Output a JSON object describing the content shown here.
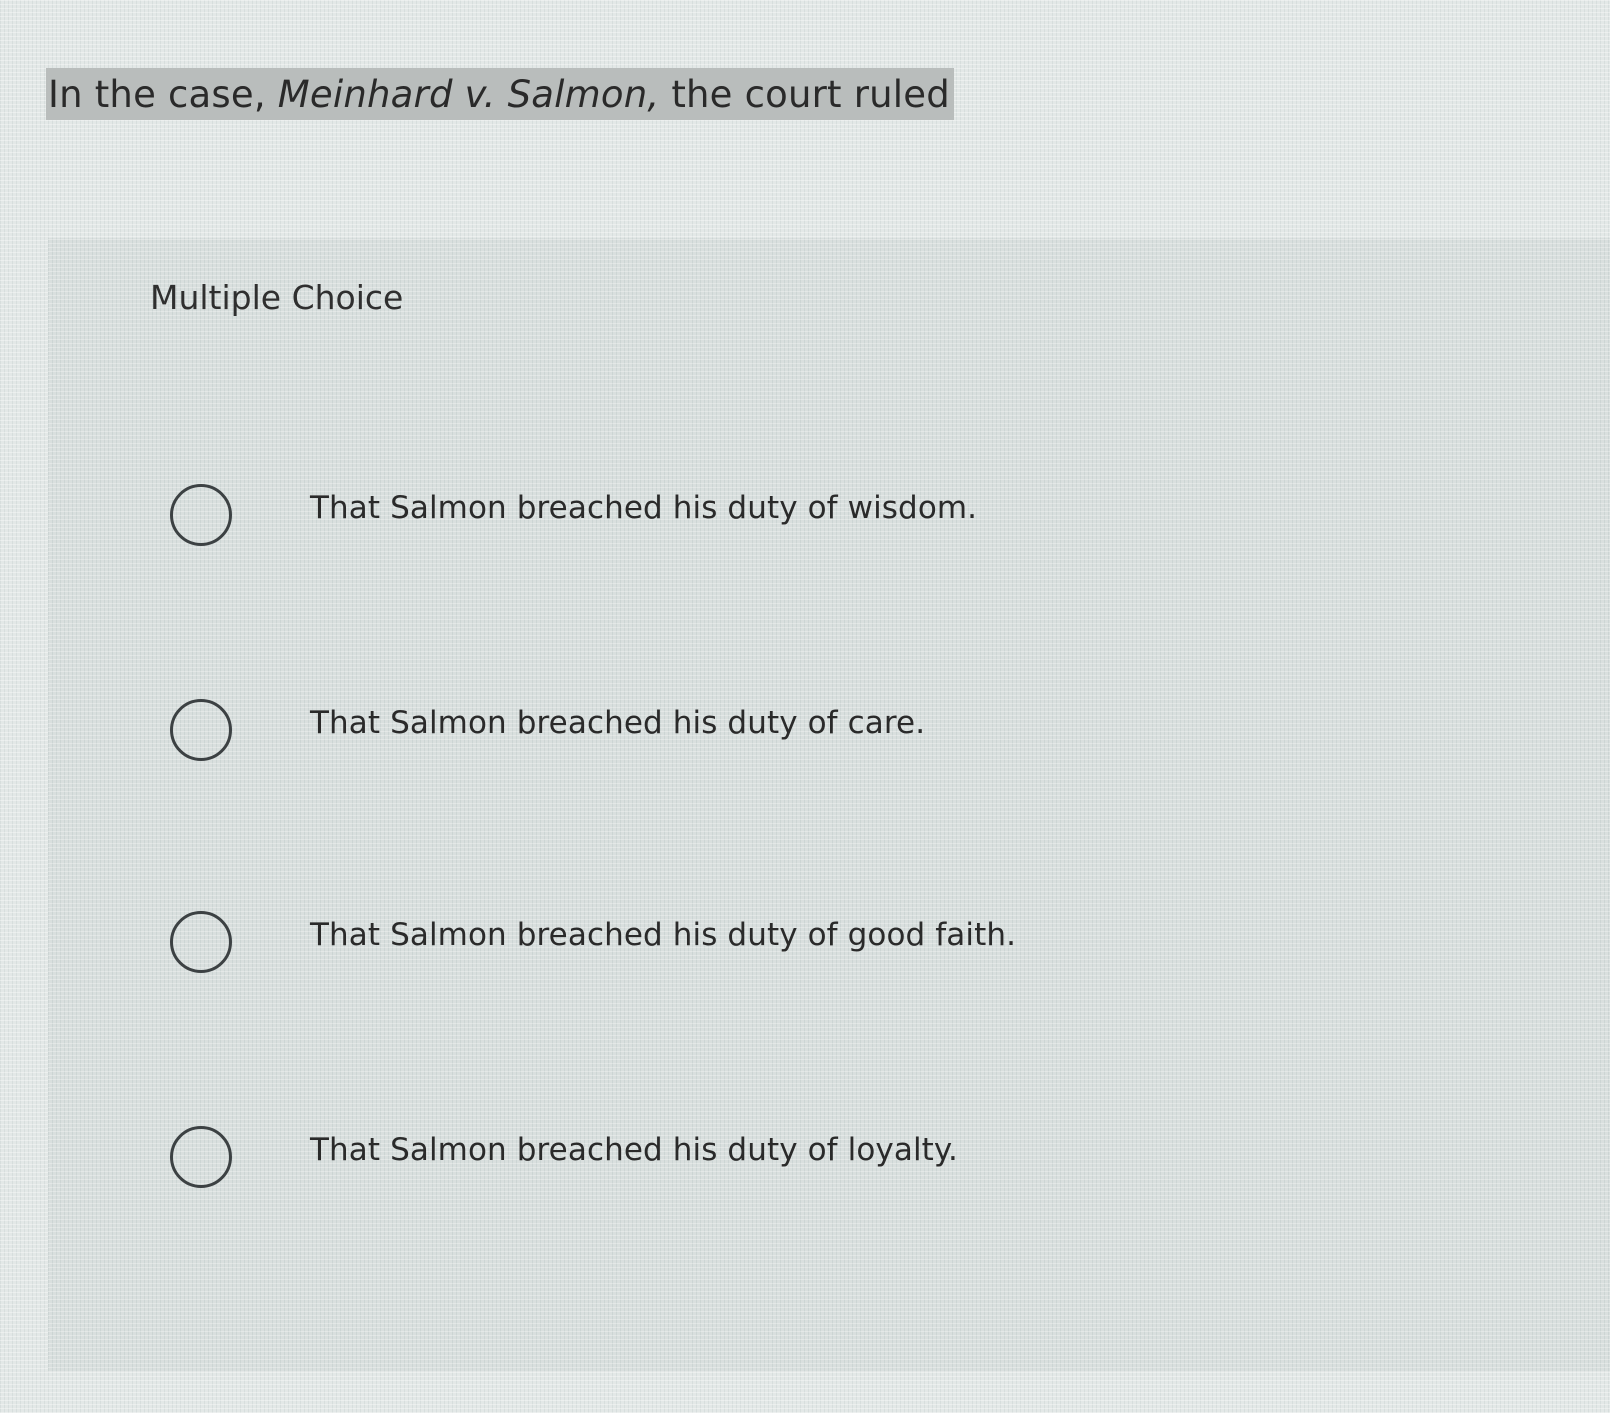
{
  "question": {
    "prefix": "In the case,",
    "case_name": "Meinhard v. Salmon,",
    "suffix": "the court ruled"
  },
  "panel": {
    "label": "Multiple Choice"
  },
  "options": [
    {
      "text": "That Salmon breached his duty of wisdom.",
      "selected": false
    },
    {
      "text": "That Salmon breached his duty of care.",
      "selected": false
    },
    {
      "text": "That Salmon breached his duty of good faith.",
      "selected": false
    },
    {
      "text": "That Salmon breached his duty of loyalty.",
      "selected": false
    }
  ],
  "colors": {
    "question_highlight": "#b9bdbc",
    "radio_border": "#3c4143",
    "text": "#2a2a2a"
  }
}
